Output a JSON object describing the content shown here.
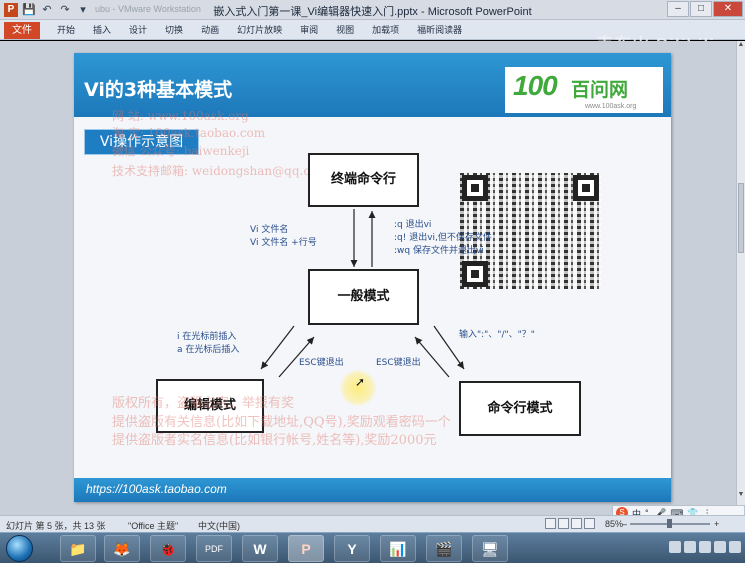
{
  "window": {
    "title": "嵌入式入门第一课_Vi编辑器快速入门.pptx - Microsoft PowerPoint",
    "app_icon_label": "P",
    "faded_title": "ubu - VMware Workstation",
    "min_label": "–",
    "max_label": "□",
    "close_label": "✕"
  },
  "ribbon": {
    "file_tab": "文件",
    "tabs": [
      "开始",
      "插入",
      "设计",
      "切换",
      "动画",
      "幻灯片放映",
      "审阅",
      "视图",
      "加载项",
      "福昕阅读器"
    ],
    "overlay_name": "韦东山 Bilibili"
  },
  "slide": {
    "title": "Vi的3种基本模式",
    "logo": {
      "number": "100",
      "text": "百问网",
      "url": "www.100ask.org"
    },
    "subtitle": "Vi操作示意图",
    "watermark_top": [
      "网          站: www.100ask.org",
      "淘          宝: 100ask.taobao.com",
      "微信   公众号: baiwenkeji",
      "技术支持邮箱: weidongshan@qq.com"
    ],
    "watermark_bottom": [
      "版权所有，盗版必究，举报有奖",
      "提供盗版有关信息(比如下载地址,QQ号),奖励观看密码一个",
      "提供盗版者实名信息(比如银行帐号,姓名等),奖励2000元"
    ],
    "modes": {
      "terminal": "终端命令行",
      "normal": "一般模式",
      "edit": "编辑模式",
      "command": "命令行模式"
    },
    "notes": {
      "enter_vi_1": "Vi 文件名",
      "enter_vi_2": "Vi  文件名  +行号",
      "quit_1": ":q   退出vi",
      "quit_2": ":q!  退出vi,但不保存文件",
      "quit_3": ":wq 保存文件并退出vi",
      "insert_1": "i  在光标前插入",
      "insert_2": "a 在光标后插入",
      "esc_left": "ESC键退出",
      "esc_right": "ESC键退出",
      "input_cmd": "输入\":\"、\"/\"、\"？\""
    },
    "footer_url": "https://100ask.taobao.com"
  },
  "statusbar": {
    "slide_info": "幻灯片 第 5 张，共 13 张",
    "theme": "\"Office 主题\"",
    "language": "中文(中国)",
    "zoom": "85%",
    "zoom_minus": "–",
    "zoom_plus": "+"
  },
  "ime": {
    "logo": "S",
    "label": "中"
  },
  "taskbar": {
    "apps": [
      "📁",
      "🦊",
      "🐞",
      "PDF",
      "W",
      "P",
      "Y",
      "📊",
      "🎬",
      "🖥"
    ]
  },
  "colors": {
    "header_blue": "#1d78ba",
    "logo_green": "#3fa93b",
    "watermark_red": "#e1786e",
    "file_tab": "#d24726"
  }
}
